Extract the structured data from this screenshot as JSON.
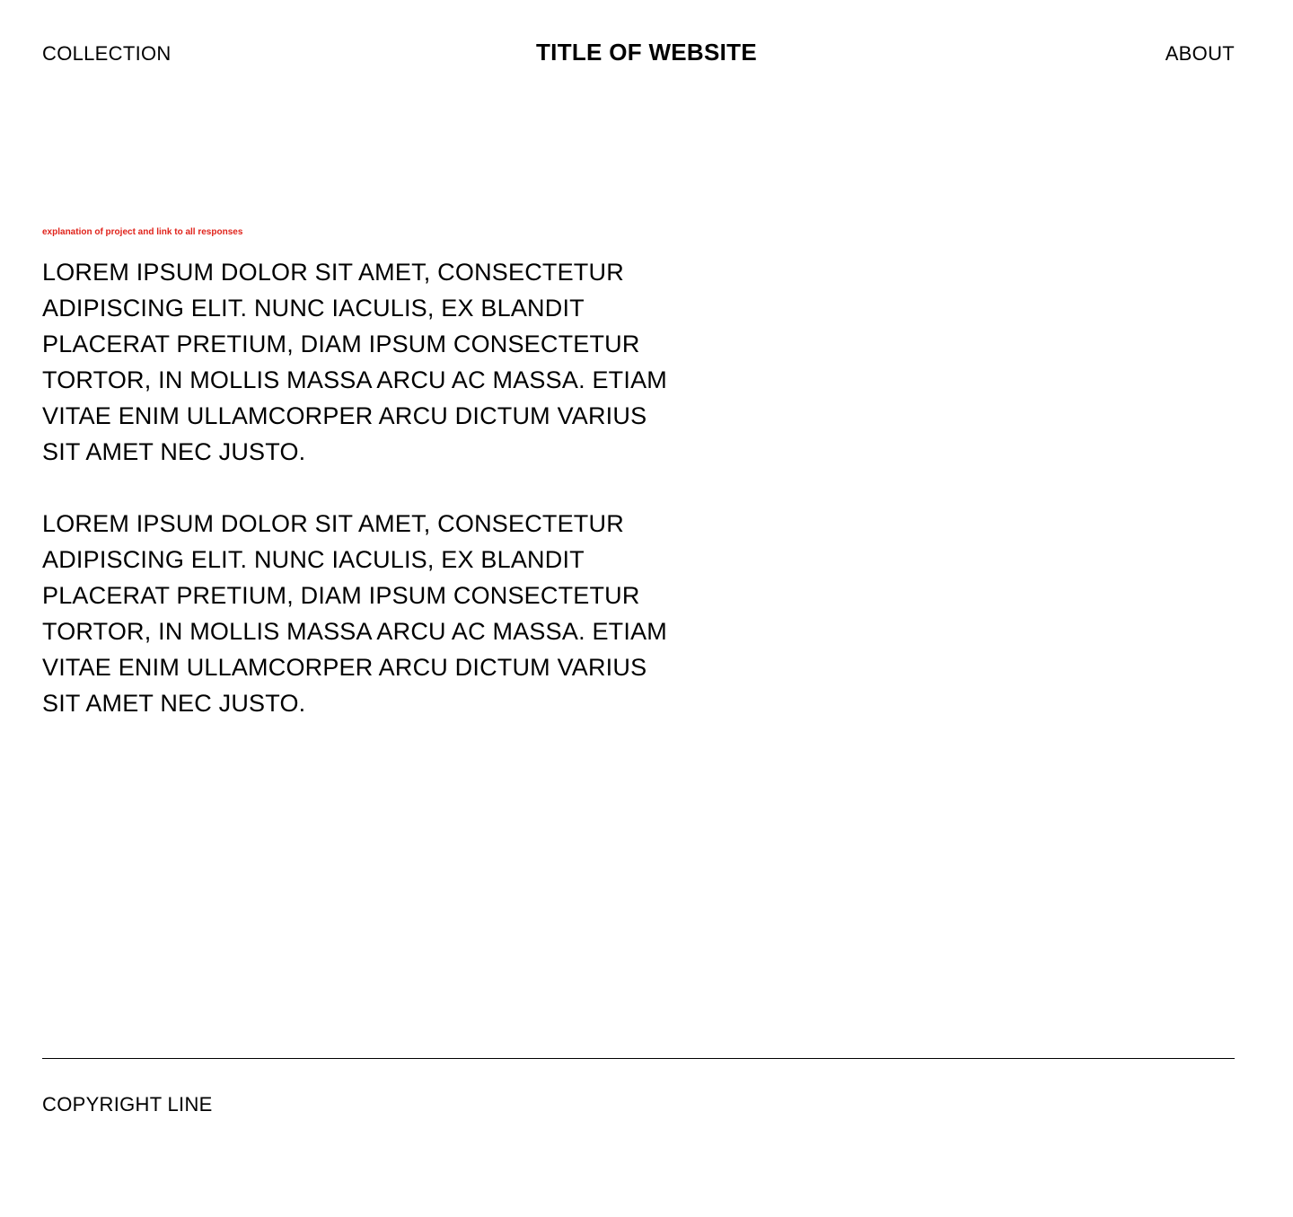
{
  "header": {
    "collection_label": "COLLECTION",
    "site_title": "TITLE OF WEBSITE",
    "about_label": "ABOUT"
  },
  "main": {
    "explanation_link": "explanation of project and link to all responses",
    "paragraphs": [
      "LOREM IPSUM DOLOR SIT AMET, CONSECTETUR ADIPISCING ELIT. NUNC IACULIS, EX BLANDIT PLACERAT PRETIUM, DIAM IPSUM CONSECTETUR TORTOR, IN MOLLIS MASSA ARCU AC MASSA. ETIAM VITAE ENIM ULLAMCORPER ARCU DICTUM VARIUS SIT AMET NEC JUSTO.",
      "LOREM IPSUM DOLOR SIT AMET, CONSECTETUR ADIPISCING ELIT. NUNC IACULIS, EX BLANDIT PLACERAT PRETIUM, DIAM IPSUM CONSECTETUR TORTOR, IN MOLLIS MASSA ARCU AC MASSA. ETIAM VITAE ENIM ULLAMCORPER ARCU DICTUM VARIUS SIT AMET NEC JUSTO."
    ]
  },
  "footer": {
    "copyright": "COPYRIGHT LINE"
  },
  "colors": {
    "background": "#ffffff",
    "text": "#000000",
    "accent_link": "#e0231b"
  }
}
